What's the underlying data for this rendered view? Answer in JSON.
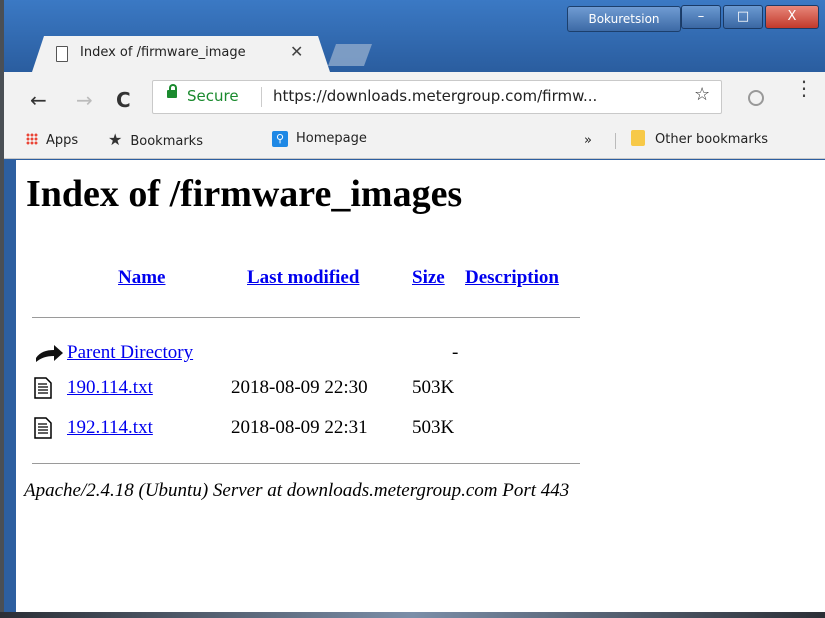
{
  "window": {
    "profile_label": "Bokuretsion",
    "minimize": "–",
    "maximize": "□",
    "close": "X"
  },
  "tab": {
    "title": "Index of /firmware_image",
    "close": "✕"
  },
  "toolbar": {
    "back": "←",
    "forward": "→",
    "reload": "C",
    "secure_label": "Secure",
    "url": "https://downloads.metergroup.com/firmw...",
    "star": "☆",
    "menu": "⋮"
  },
  "bookmarks": {
    "apps": "Apps",
    "bookmarks": "Bookmarks",
    "homepage": "Homepage",
    "more": "»",
    "other": "Other bookmarks"
  },
  "page": {
    "title": "Index of /firmware_images",
    "columns": {
      "name": "Name",
      "last_modified": "Last modified",
      "size": "Size",
      "description": "Description"
    },
    "parent": {
      "label": "Parent Directory",
      "size": "-"
    },
    "files": [
      {
        "name": "190.114.txt",
        "modified": "2018-08-09 22:30",
        "size": "503K"
      },
      {
        "name": "192.114.txt",
        "modified": "2018-08-09 22:31",
        "size": "503K"
      }
    ],
    "footer": "Apache/2.4.18 (Ubuntu) Server at downloads.metergroup.com Port 443"
  },
  "colors": {
    "link": "#0000ee",
    "secure": "#1a8a2e",
    "titlebar": "#2d5fa0"
  }
}
